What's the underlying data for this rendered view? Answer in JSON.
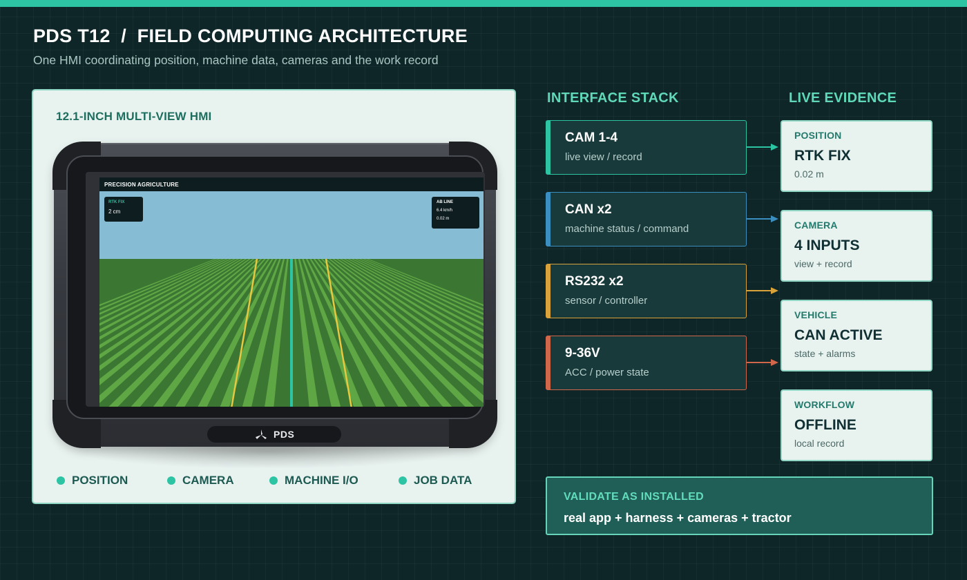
{
  "header": {
    "title": "PDS T12  /  FIELD COMPUTING ARCHITECTURE",
    "subtitle": "One HMI coordinating position, machine data, cameras and the work record"
  },
  "hmi_panel": {
    "title": "12.1-INCH MULTI-VIEW HMI",
    "screen": {
      "header": "PRECISION AGRICULTURE",
      "rtk_label": "RTK FIX",
      "rtk_value": "2 cm",
      "ab_label": "AB LINE",
      "ab_speed": "6.4 km/h",
      "ab_offset": "0.02 m"
    },
    "brand": "PDS",
    "legend": [
      {
        "label": "POSITION"
      },
      {
        "label": "CAMERA"
      },
      {
        "label": "MACHINE I/O"
      },
      {
        "label": "JOB DATA"
      }
    ]
  },
  "interface_stack": {
    "heading": "INTERFACE STACK",
    "items": [
      {
        "title": "CAM 1-4",
        "sub": "live view / record",
        "color": "#2cc4a2"
      },
      {
        "title": "CAN x2",
        "sub": "machine status / command",
        "color": "#3b8fc0"
      },
      {
        "title": "RS232 x2",
        "sub": "sensor / controller",
        "color": "#d9a23a"
      },
      {
        "title": "9-36V",
        "sub": "ACC / power state",
        "color": "#d0674a"
      }
    ]
  },
  "live_evidence": {
    "heading": "LIVE EVIDENCE",
    "items": [
      {
        "label": "POSITION",
        "value": "RTK FIX",
        "sub": "0.02 m"
      },
      {
        "label": "CAMERA",
        "value": "4 INPUTS",
        "sub": "view + record"
      },
      {
        "label": "VEHICLE",
        "value": "CAN ACTIVE",
        "sub": "state + alarms"
      },
      {
        "label": "WORKFLOW",
        "value": "OFFLINE",
        "sub": "local record"
      }
    ]
  },
  "validate": {
    "label": "VALIDATE AS INSTALLED",
    "text": "real app + harness + cameras + tractor"
  },
  "colors": {
    "accent": "#2cc4a2",
    "background": "#0f2629",
    "heading": "#5fd9b7"
  }
}
